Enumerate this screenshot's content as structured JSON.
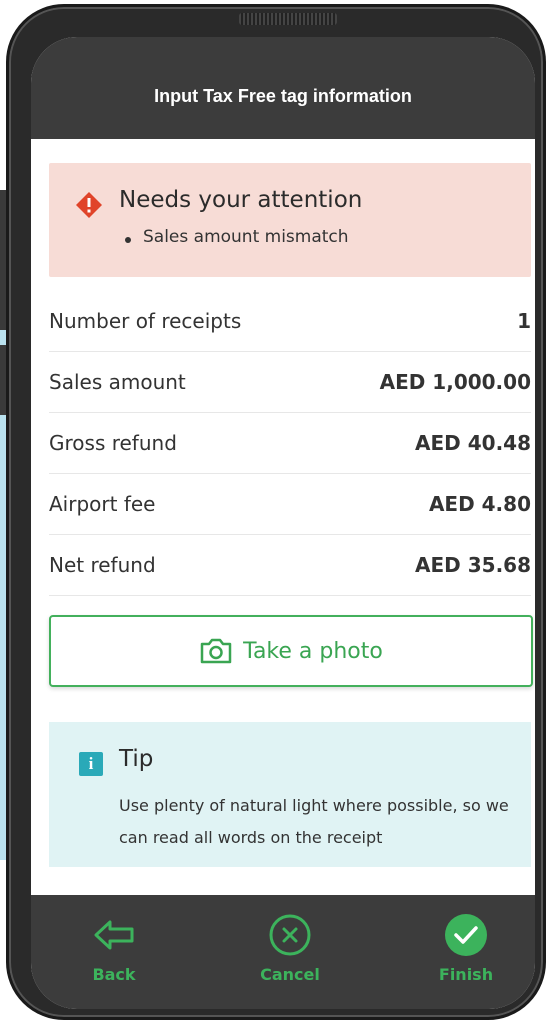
{
  "header": {
    "title": "Input Tax Free tag information"
  },
  "alert": {
    "icon": "warning-diamond-icon",
    "heading": "Needs your attention",
    "items": [
      "Sales amount mismatch"
    ],
    "color": "#f7dcd6"
  },
  "summary": {
    "rows": [
      {
        "label": "Number of receipts",
        "value": "1"
      },
      {
        "label": "Sales amount",
        "value": "AED 1,000.00"
      },
      {
        "label": "Gross refund",
        "value": "AED 40.48"
      },
      {
        "label": "Airport fee",
        "value": "AED 4.80"
      },
      {
        "label": "Net refund",
        "value": "AED 35.68"
      }
    ]
  },
  "photo_button": {
    "icon": "camera-icon",
    "label": "Take a photo"
  },
  "tip": {
    "icon": "info-icon",
    "title": "Tip",
    "text": "Use plenty of natural light where possible, so we can read all words on the receipt"
  },
  "bottom_nav": {
    "back": {
      "icon": "arrow-left-icon",
      "label": "Back"
    },
    "cancel": {
      "icon": "close-circle-icon",
      "label": "Cancel"
    },
    "finish": {
      "icon": "check-circle-icon",
      "label": "Finish"
    }
  },
  "colors": {
    "accent": "#3cb35c",
    "bar": "#3c3c3c",
    "tip_bg": "#e0f3f4",
    "warning": "#e0442a"
  }
}
